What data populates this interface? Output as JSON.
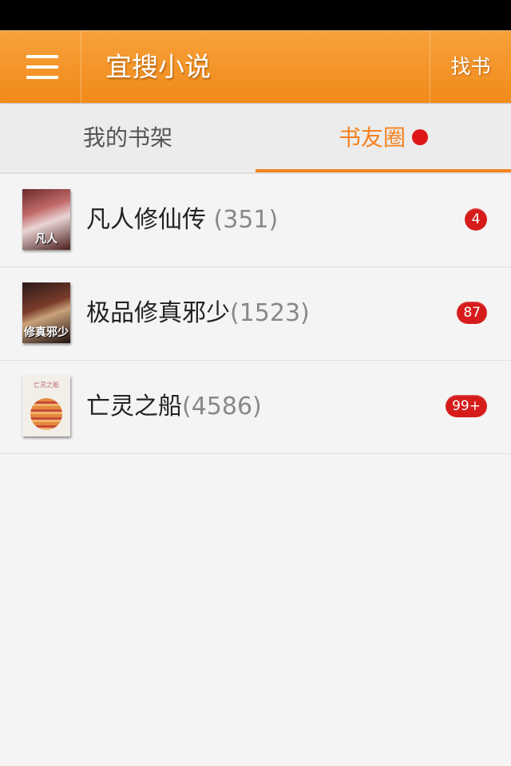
{
  "app": {
    "title": "宜搜小说",
    "find_label": "找书"
  },
  "tabs": [
    {
      "label": "我的书架",
      "active": false
    },
    {
      "label": "书友圈",
      "active": true,
      "has_dot": true
    }
  ],
  "books": [
    {
      "title": "凡人修仙传",
      "count": "(351)",
      "badge": "4",
      "cover_text": "凡人"
    },
    {
      "title": "极品修真邪少",
      "count": "(1523)",
      "badge": "87",
      "cover_text": "修真邪少"
    },
    {
      "title": "亡灵之船",
      "count": "(4586)",
      "badge": "99+",
      "cover_text": "亡灵之船"
    }
  ],
  "colors": {
    "accent": "#f5821f",
    "appbar": "#f18a1a",
    "badge": "#d61b1b"
  }
}
